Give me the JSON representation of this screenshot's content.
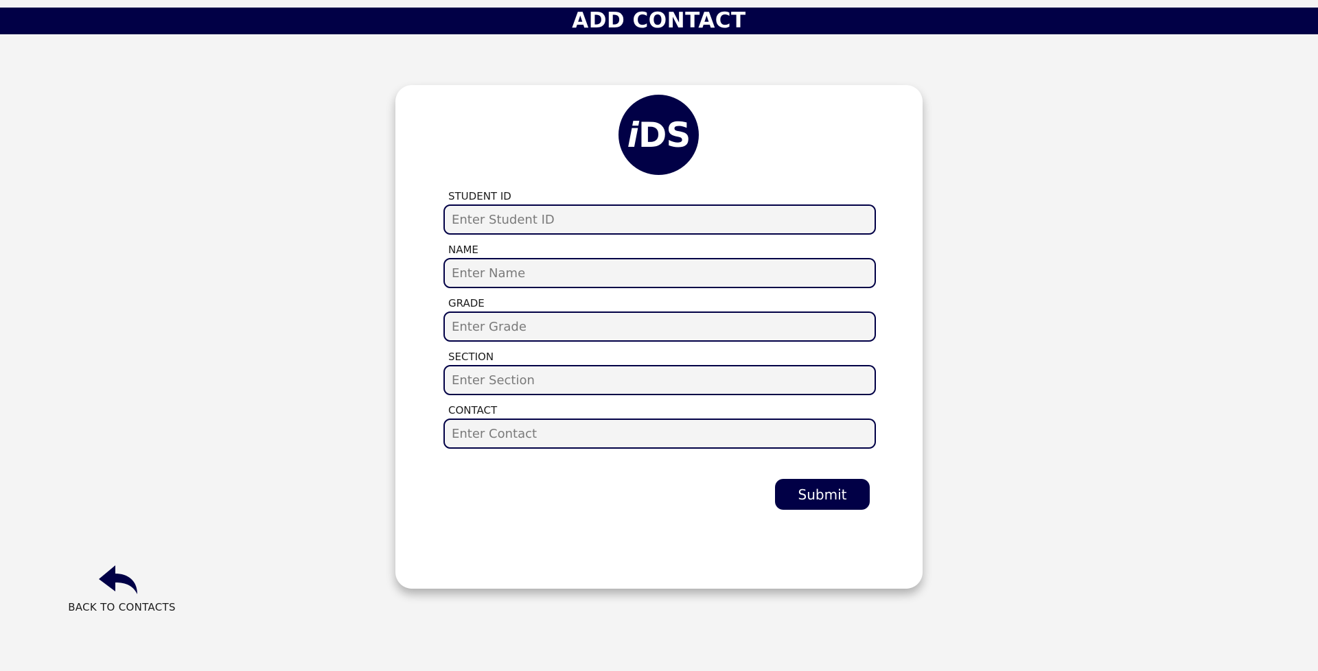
{
  "header": {
    "title": "ADD CONTACT"
  },
  "logo": {
    "text_i": "i",
    "text_rest": "DS"
  },
  "form": {
    "fields": [
      {
        "label": "STUDENT ID",
        "placeholder": "Enter Student ID",
        "value": ""
      },
      {
        "label": "NAME",
        "placeholder": "Enter Name",
        "value": ""
      },
      {
        "label": "GRADE",
        "placeholder": "Enter Grade",
        "value": ""
      },
      {
        "label": "SECTION",
        "placeholder": "Enter Section",
        "value": ""
      },
      {
        "label": "CONTACT",
        "placeholder": "Enter Contact",
        "value": ""
      }
    ],
    "submit_label": "Submit"
  },
  "back": {
    "label": "BACK TO CONTACTS",
    "icon": "reply-arrow-icon"
  },
  "colors": {
    "primary": "#010046",
    "background": "#f4f4f4",
    "card": "#ffffff"
  }
}
